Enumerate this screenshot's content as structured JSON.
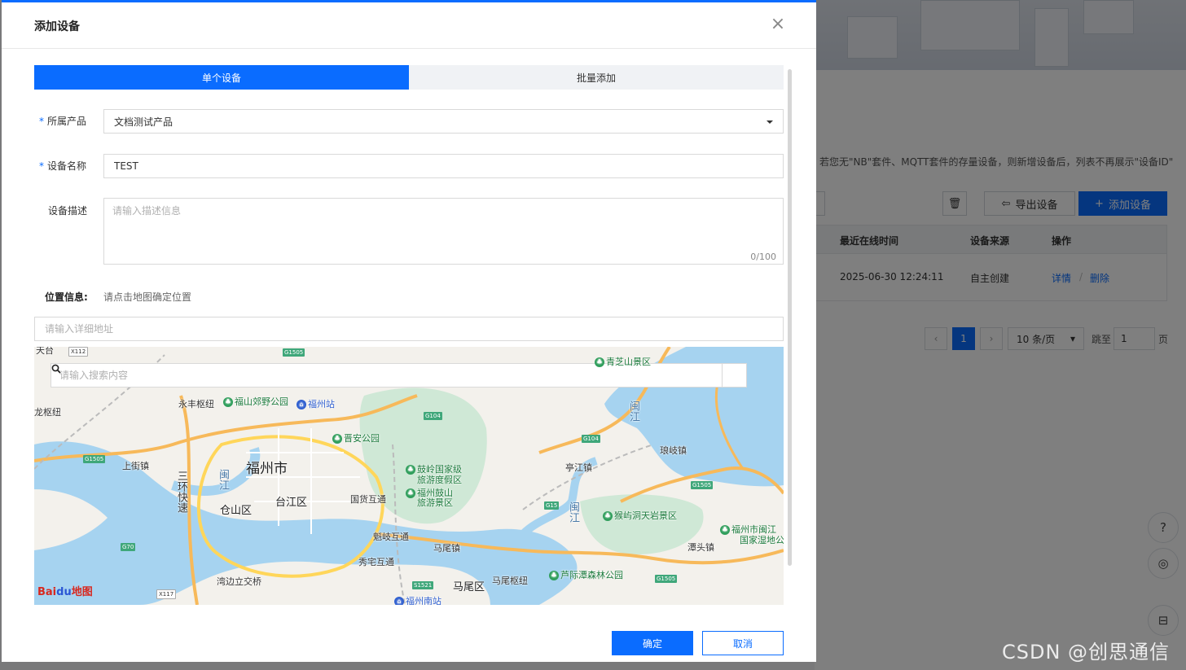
{
  "modal": {
    "title": "添加设备",
    "tabs": [
      {
        "label": "单个设备",
        "active": true
      },
      {
        "label": "批量添加",
        "active": false
      }
    ],
    "fields": {
      "product": {
        "label": "所属产品",
        "required": true,
        "value": "文档测试产品"
      },
      "device_name": {
        "label": "设备名称",
        "required": true,
        "value": "TEST"
      },
      "description": {
        "label": "设备描述",
        "placeholder": "请输入描述信息",
        "counter": "0/100"
      }
    },
    "required_mark": "*",
    "location": {
      "label": "位置信息:",
      "hint": "请点击地图确定位置",
      "address_placeholder": "请输入详细地址",
      "map_search_placeholder": "请输入搜索内容"
    },
    "buttons": {
      "ok": "确定",
      "cancel": "取消"
    }
  },
  "map": {
    "labels": {
      "city": "福州市",
      "taijiang": "台江区",
      "cangshan": "仓山区",
      "mawei": "马尾区",
      "yongfeng": "永丰枢纽",
      "fushan_park": "福山郊野公园",
      "fuzhou_station": "福州站",
      "jinan_park": "晋安公园",
      "guling1": "鼓岭国家级",
      "guling2": "旅游度假区",
      "gushan1": "福州鼓山",
      "gushan2": "旅游景区",
      "guohuo": "国货互通",
      "kuiqi": "魁岐互通",
      "xiuzhai": "秀宅互通",
      "mawei_town": "马尾镇",
      "mawei_hub": "马尾枢纽",
      "tingjiang": "亭江镇",
      "langqi": "琅岐镇",
      "houyudong": "猴屿洞天岩景区",
      "tantou": "潭头镇",
      "minjiang_wetland1": "福州市闽江",
      "minjiang_wetland2": "国家湿地公",
      "shangjie": "上街镇",
      "sanhuan": "三环快速",
      "minjiang1": "闽江",
      "minjiang2": "闽江",
      "minjiang3": "闽江",
      "longshu": "龙枢纽",
      "wanbian": "湾边立交桥",
      "luji": "芦际潭森林公园",
      "fuzhou_south": "福州南站",
      "top_left": "天台",
      "top_park": "青芝山景区"
    },
    "roads": {
      "x112": "X112",
      "g1505a": "G1505",
      "g1505b": "G1505",
      "g1505c": "G1505",
      "g1505d": "G1505",
      "g104a": "G104",
      "g104b": "G104",
      "g15": "G15",
      "g70": "G70",
      "s1521": "S1521",
      "x117": "X117"
    },
    "logo": {
      "part1": "Bai",
      "part2": "du",
      "part3": "地图"
    }
  },
  "background": {
    "notice": "若您无\"NB\"套件、MQTT套件的存量设备，则新增设备后，列表不再展示\"设备ID\"",
    "export_button": "导出设备",
    "add_button": "添加设备",
    "table": {
      "headers": [
        "最近在线时间",
        "设备来源",
        "操作"
      ],
      "row": {
        "time": "2025-06-30 12:24:11",
        "source": "自主创建",
        "detail": "详情",
        "separator": "/",
        "delete": "删除"
      }
    },
    "pagination": {
      "prev": "‹",
      "page": "1",
      "next": "›",
      "page_size": "10 条/页",
      "jump_label": "跳至",
      "jump_value": "1",
      "page_suffix": "页"
    },
    "watermark": "CSDN @创思通信"
  }
}
